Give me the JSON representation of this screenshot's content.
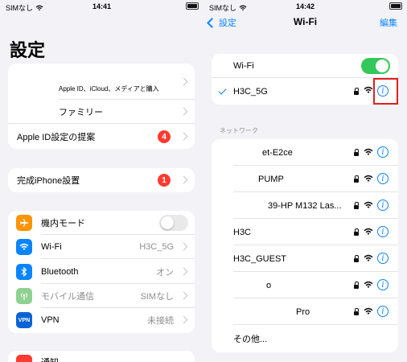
{
  "left": {
    "status": {
      "carrier": "SIMなし",
      "time": "14:41"
    },
    "title": "設定",
    "appleid_sub": "Apple ID、iCloud、メディアと購入",
    "family": "ファミリー",
    "suggest": {
      "label": "Apple ID設定の提案",
      "badge": "4"
    },
    "complete": {
      "label": "完成iPhone設置",
      "badge": "1"
    },
    "settings": [
      {
        "label": "機内モード",
        "value": "",
        "icon": "airplane-icon",
        "color": "#ff9500"
      },
      {
        "label": "Wi-Fi",
        "value": "H3C_5G",
        "icon": "wifi-icon",
        "color": "#0a84ff"
      },
      {
        "label": "Bluetooth",
        "value": "オン",
        "icon": "bluetooth-icon",
        "color": "#0a84ff"
      },
      {
        "label": "モバイル通信",
        "value": "SIMなし",
        "icon": "antenna-icon",
        "color": "#8fd18f"
      },
      {
        "label": "VPN",
        "value": "未接続",
        "icon": "vpn-icon",
        "color": "#0a63d4",
        "icon_text": "VPN"
      }
    ],
    "partial_label": "通知"
  },
  "right": {
    "status": {
      "carrier": "SIMなし",
      "time": "14:42"
    },
    "back": "設定",
    "title": "Wi-Fi",
    "edit": "編集",
    "wifi_label": "Wi-Fi",
    "connected": "H3C_5G",
    "section_header": "ネットワーク",
    "networks": [
      {
        "name": "et-E2ce"
      },
      {
        "name": "PUMP"
      },
      {
        "name": "39-HP M132 Las..."
      },
      {
        "name": "H3C"
      },
      {
        "name": "H3C_GUEST"
      },
      {
        "name": "o"
      },
      {
        "name": "Pro"
      }
    ],
    "other": "その他..."
  },
  "colors": {
    "accent": "#0a84ff",
    "toggle_on": "#34c759",
    "badge": "#ff3b30",
    "highlight_box": "#e0201d"
  }
}
